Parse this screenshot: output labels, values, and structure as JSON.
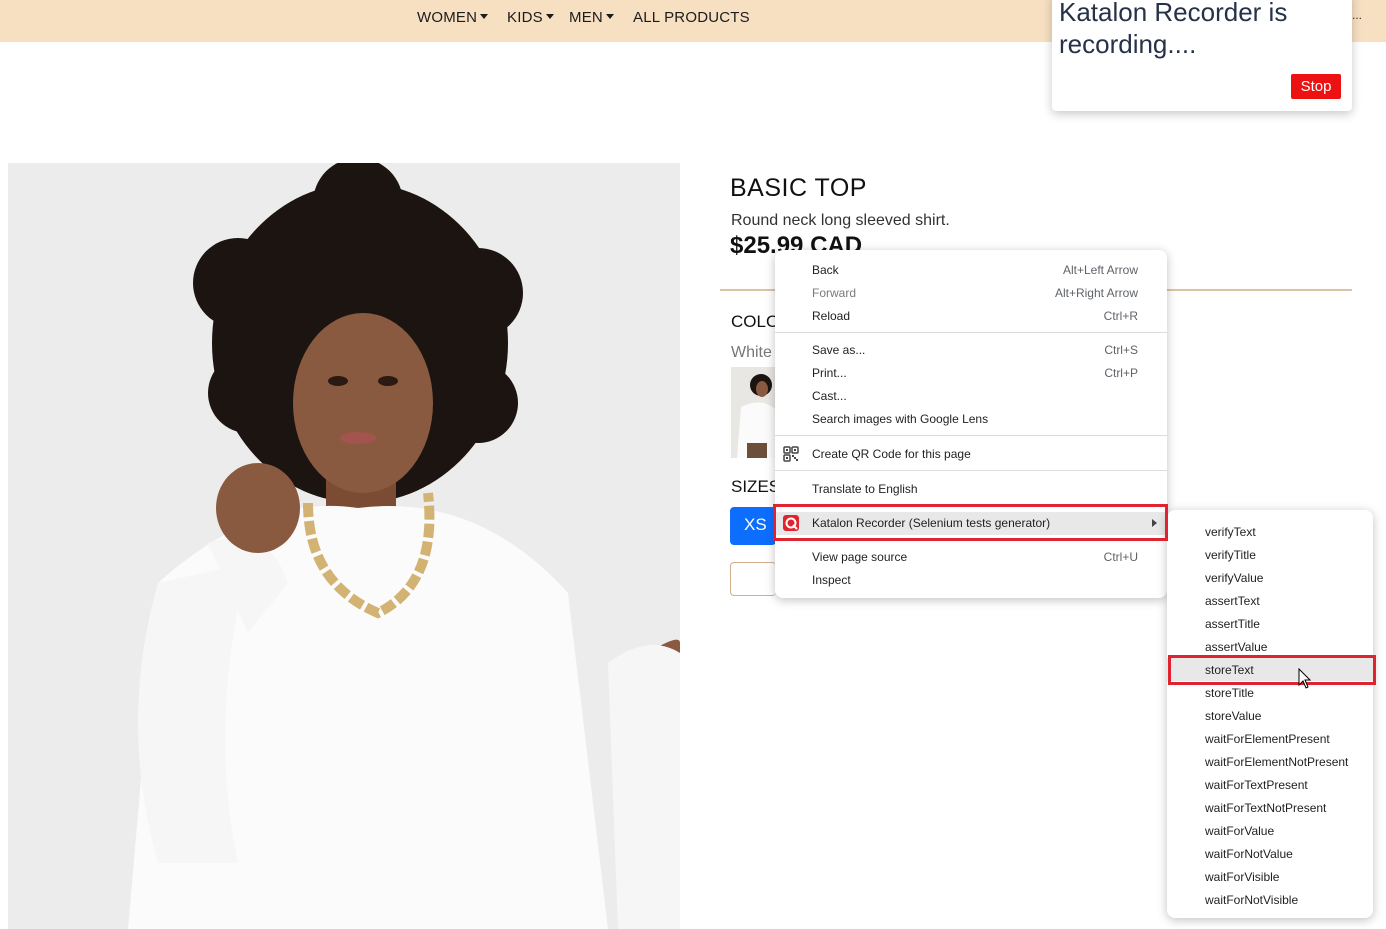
{
  "nav": {
    "items": [
      {
        "label": "WOMEN",
        "has_dropdown": true
      },
      {
        "label": "KIDS",
        "has_dropdown": true
      },
      {
        "label": "MEN",
        "has_dropdown": true
      },
      {
        "label": "ALL PRODUCTS",
        "has_dropdown": false
      }
    ],
    "overflow": "..."
  },
  "recorder_popup": {
    "title": "Katalon Recorder is recording....",
    "stop_label": "Stop"
  },
  "product": {
    "title": "BASIC TOP",
    "description": "Round neck long sleeved shirt.",
    "price": "$25.99 CAD",
    "color_heading": "COLOR",
    "color_value": "White",
    "sizes_heading": "SIZES",
    "selected_size": "XS"
  },
  "context_menu": {
    "items": [
      {
        "label": "Back",
        "shortcut": "Alt+Left Arrow",
        "disabled": false
      },
      {
        "label": "Forward",
        "shortcut": "Alt+Right Arrow",
        "disabled": true
      },
      {
        "label": "Reload",
        "shortcut": "Ctrl+R",
        "disabled": false
      },
      {
        "label": "Save as...",
        "shortcut": "Ctrl+S",
        "disabled": false
      },
      {
        "label": "Print...",
        "shortcut": "Ctrl+P",
        "disabled": false
      },
      {
        "label": "Cast...",
        "shortcut": "",
        "disabled": false
      },
      {
        "label": "Search images with Google Lens",
        "shortcut": "",
        "disabled": false
      },
      {
        "label": "Create QR Code for this page",
        "shortcut": "",
        "icon": "qr-code-icon"
      },
      {
        "label": "Translate to English",
        "shortcut": ""
      },
      {
        "label": "Katalon Recorder (Selenium tests generator)",
        "shortcut": "",
        "icon": "katalon-icon",
        "has_submenu": true
      },
      {
        "label": "View page source",
        "shortcut": "Ctrl+U"
      },
      {
        "label": "Inspect",
        "shortcut": ""
      }
    ]
  },
  "submenu": {
    "items": [
      "verifyText",
      "verifyTitle",
      "verifyValue",
      "assertText",
      "assertTitle",
      "assertValue",
      "storeText",
      "storeTitle",
      "storeValue",
      "waitForElementPresent",
      "waitForElementNotPresent",
      "waitForTextPresent",
      "waitForTextNotPresent",
      "waitForValue",
      "waitForNotValue",
      "waitForVisible",
      "waitForNotVisible"
    ],
    "hovered": "storeText"
  },
  "colors": {
    "nav_bg": "#f7dfc2",
    "stop_button": "#ee1111",
    "size_button": "#0d6efd",
    "annotation": "#e0242f"
  }
}
